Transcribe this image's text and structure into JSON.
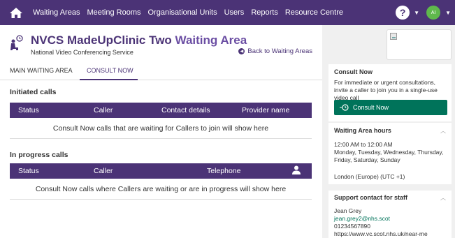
{
  "nav": {
    "home_icon": "home-icon",
    "items": [
      "Waiting Areas",
      "Meeting Rooms",
      "Organisational Units",
      "Users",
      "Reports",
      "Resource Centre"
    ],
    "help_label": "?",
    "avatar_initials": "AI"
  },
  "header": {
    "title_part1": "NVCS MadeUpClinic Two",
    "title_part2": "Waiting Area",
    "subtitle": "National Video Conferencing Service",
    "back_link": "Back to Waiting Areas"
  },
  "tabs": [
    "MAIN WAITING AREA",
    "CONSULT NOW"
  ],
  "initiated": {
    "title": "Initiated calls",
    "columns": [
      "Status",
      "Caller",
      "Contact details",
      "Provider name"
    ],
    "empty_message": "Consult Now calls that are waiting for Callers to join will show here"
  },
  "in_progress": {
    "title": "In progress calls",
    "columns": [
      "Status",
      "Caller",
      "Telephone"
    ],
    "empty_message": "Consult Now calls where Callers are waiting or are in progress will show here"
  },
  "sidebar": {
    "consult_now": {
      "title": "Consult Now",
      "description": "For immediate or urgent consultations, invite a caller to join you in a single-use video call",
      "button_label": "Consult Now"
    },
    "hours": {
      "title": "Waiting Area hours",
      "time_range": "12:00 AM to 12:00 AM",
      "days": "Monday, Tuesday, Wednesday, Thursday, Friday, Saturday, Sunday",
      "timezone": "London (Europe) (UTC +1)"
    },
    "support": {
      "title": "Support contact for staff",
      "name": "Jean Grey",
      "email": "jean.grey2@nhs.scot",
      "phone": "01234567890",
      "url": "https://www.vc.scot.nhs.uk/near-me"
    }
  },
  "colors": {
    "brand_purple": "#4b3376",
    "accent_green": "#00735a",
    "avatar_green": "#5fb84c"
  }
}
